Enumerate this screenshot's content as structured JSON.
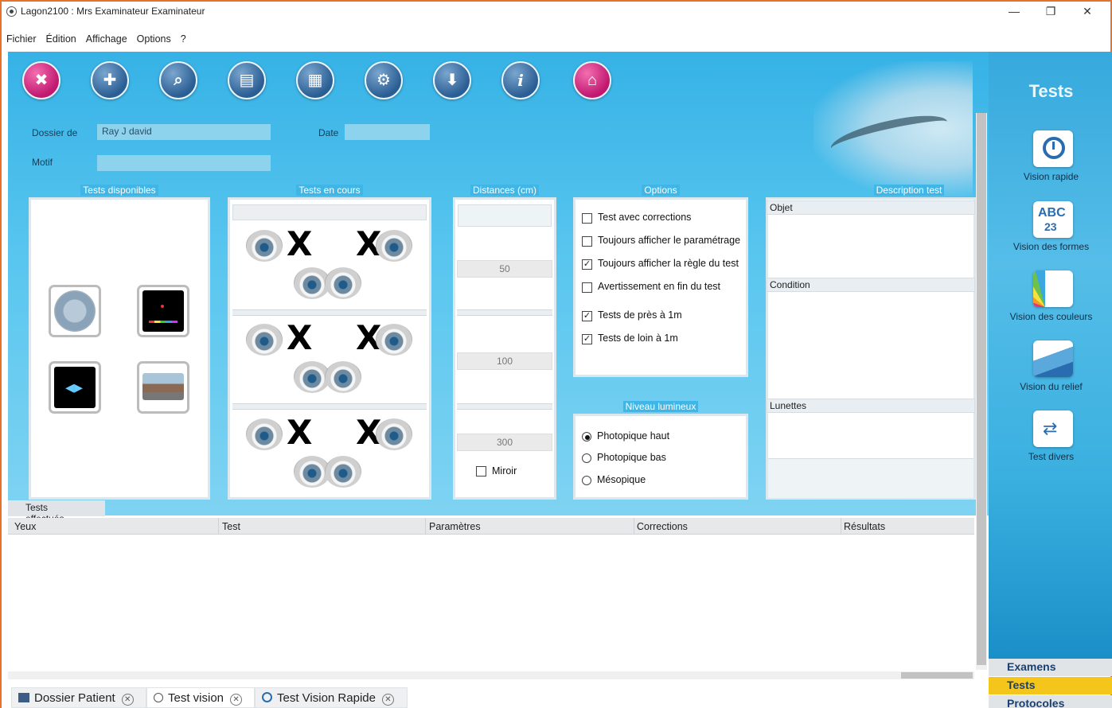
{
  "window": {
    "title": "Lagon2100  : Mrs Examinateur Examinateur",
    "minimize": "—",
    "restore": "❐",
    "close": "✕"
  },
  "menu": [
    "Fichier",
    "Édition",
    "Affichage",
    "Options",
    "?"
  ],
  "toolbar": [
    {
      "icon": "close-circle-icon",
      "glyph": "✖",
      "color": "#c0176f"
    },
    {
      "icon": "add-patient-icon",
      "glyph": "✚"
    },
    {
      "icon": "search-patient-icon",
      "glyph": "⌕"
    },
    {
      "icon": "open-folder-icon",
      "glyph": "▤"
    },
    {
      "icon": "save-document-icon",
      "glyph": "▦"
    },
    {
      "icon": "settings-gear-icon",
      "glyph": "⚙"
    },
    {
      "icon": "save-download-icon",
      "glyph": "⬇"
    },
    {
      "icon": "info-icon",
      "glyph": "i"
    },
    {
      "icon": "home-icon",
      "glyph": "⌂",
      "color": "#c0176f"
    }
  ],
  "form": {
    "dossier_label": "Dossier de",
    "dossier_value": "Ray J david",
    "date_label": "Date",
    "date_value": "",
    "motif_label": "Motif",
    "motif_value": ""
  },
  "sections": {
    "available": "Tests disponibles",
    "running": "Tests en cours",
    "distances": "Distances (cm)",
    "options": "Options",
    "description": "Description test",
    "light": "Niveau lumineux"
  },
  "distances": [
    "50",
    "100",
    "300"
  ],
  "mirror_label": "Miroir",
  "options": [
    {
      "label": "Test avec corrections",
      "checked": false
    },
    {
      "label": "Toujours afficher le paramétrage",
      "checked": false
    },
    {
      "label": "Toujours afficher la règle du test",
      "checked": true
    },
    {
      "label": "Avertissement en fin du test",
      "checked": false
    },
    {
      "label": "Tests de près à 1m",
      "checked": true
    },
    {
      "label": "Tests de loin à 1m",
      "checked": true
    }
  ],
  "light_levels": [
    {
      "label": "Photopique haut",
      "selected": true
    },
    {
      "label": "Photopique bas",
      "selected": false
    },
    {
      "label": "Mésopique",
      "selected": false
    }
  ],
  "description": {
    "objet": "Objet",
    "condition": "Condition",
    "lunettes": "Lunettes"
  },
  "results": {
    "tab": "Tests effectués",
    "columns": [
      "Yeux",
      "Test",
      "Paramètres",
      "Corrections",
      "Résultats"
    ]
  },
  "sidebar": {
    "title": "Tests",
    "items": [
      "Vision rapide",
      "Vision des formes",
      "Vision des couleurs",
      "Vision du relief",
      "Test divers"
    ],
    "nav": [
      {
        "label": "Examens",
        "color": "#e1e4e7",
        "text_color": "#1b3f6e"
      },
      {
        "label": "Tests",
        "color": "#f4c51a",
        "text_color": "#1b3f6e"
      },
      {
        "label": "Protocoles",
        "color": "#e1e4e7",
        "text_color": "#1b3f6e"
      }
    ]
  },
  "bottom_tabs": [
    "Dossier Patient",
    "Test vision",
    "Test Vision Rapide"
  ]
}
